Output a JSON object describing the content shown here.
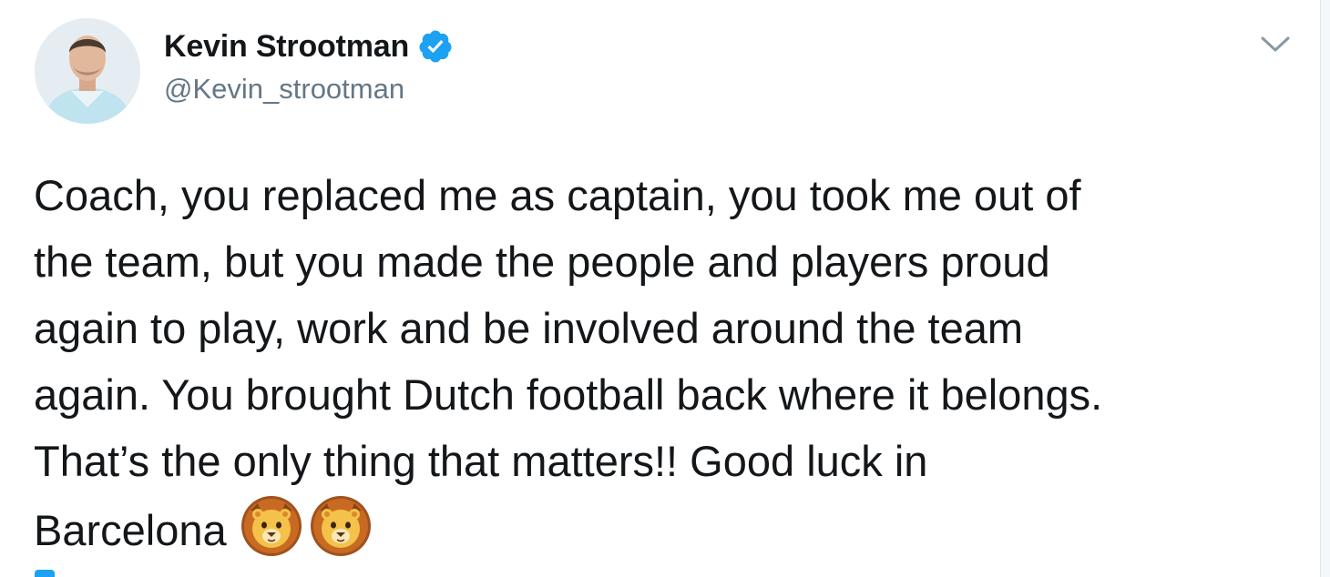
{
  "author": {
    "display_name": "Kevin Strootman",
    "handle": "@Kevin_strootman",
    "verified_icon": "verified-badge-icon",
    "avatar_icon": "profile-avatar"
  },
  "menu": {
    "icon": "chevron-down-icon"
  },
  "tweet": {
    "lines": [
      "Coach, you replaced me as captain, you took me out of",
      "the team, but you made the people and players proud",
      "again to play, work and be involved around the team",
      "again. You brought Dutch football back where it belongs.",
      "That’s the only thing that matters!! Good luck in",
      "Barcelona"
    ],
    "emojis": [
      "lion-face-icon",
      "lion-face-icon"
    ]
  },
  "colors": {
    "text": "#14171a",
    "secondary": "#657786",
    "accent": "#1da1f2"
  }
}
